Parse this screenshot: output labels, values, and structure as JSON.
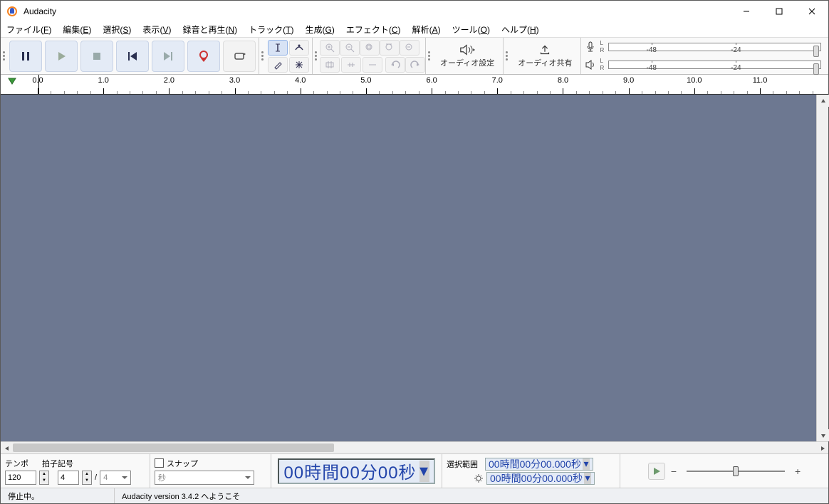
{
  "window": {
    "title": "Audacity"
  },
  "menu": {
    "file": {
      "label": "ファイル",
      "key": "F"
    },
    "edit": {
      "label": "編集",
      "key": "E"
    },
    "select": {
      "label": "選択",
      "key": "S"
    },
    "view": {
      "label": "表示",
      "key": "V"
    },
    "rec": {
      "label": "録音と再生",
      "key": "N"
    },
    "track": {
      "label": "トラック",
      "key": "T"
    },
    "gen": {
      "label": "生成",
      "key": "G"
    },
    "effect": {
      "label": "エフェクト",
      "key": "C"
    },
    "ana": {
      "label": "解析",
      "key": "A"
    },
    "tool": {
      "label": "ツール",
      "key": "O"
    },
    "help": {
      "label": "ヘルプ",
      "key": "H"
    }
  },
  "toolbar": {
    "audio_setup": "オーディオ設定",
    "audio_share": "オーディオ共有"
  },
  "meter": {
    "labels": [
      "-48",
      "-24"
    ],
    "channels": [
      "L",
      "R"
    ]
  },
  "ruler": {
    "marks": [
      "0.0",
      "1.0",
      "2.0",
      "3.0",
      "4.0",
      "5.0",
      "6.0",
      "7.0",
      "8.0",
      "9.0",
      "10.0",
      "11.0"
    ]
  },
  "bottom": {
    "tempo_label": "テンポ",
    "tempo_value": "120",
    "timesig_label": "拍子記号",
    "timesig_num": "4",
    "timesig_den": "4",
    "timesig_sep": "/",
    "snap_label": "スナップ",
    "snap_unit": "秒",
    "big_time": "00時間00分00秒",
    "sel_label": "選択範囲",
    "sel_start": "00時間00分00.000秒",
    "sel_end": "00時間00分00.000秒",
    "speed_minus": "−",
    "speed_plus": "+"
  },
  "status": {
    "left": "停止中。",
    "right": "Audacity version 3.4.2 へようこそ"
  }
}
